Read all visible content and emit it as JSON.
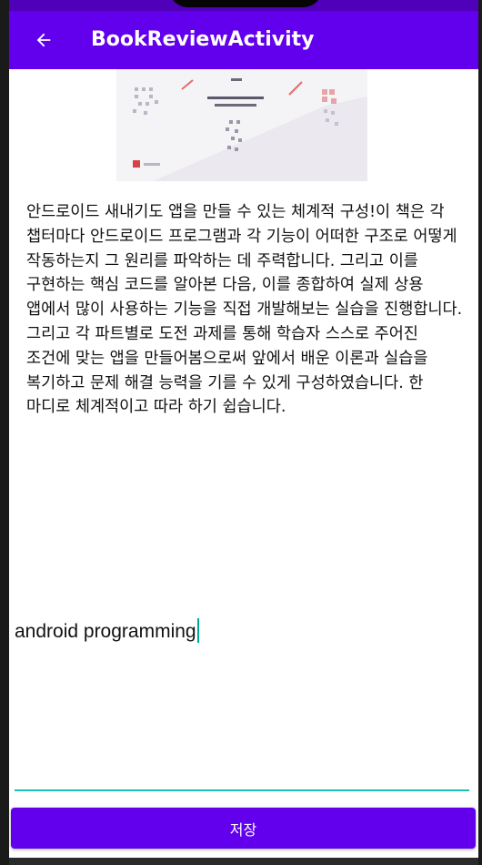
{
  "app_bar": {
    "title": "BookReviewActivity",
    "back_icon": "arrow-back-icon",
    "background": "#6200ee"
  },
  "book": {
    "cover_icon": "book-cover-image",
    "description": "안드로이드 새내기도 앱을 만들 수 있는 체계적 구성!이 책은 각 챕터마다 안드로이드 프로그램과 각 기능이 어떠한 구조로 어떻게 작동하는지 그 원리를 파악하는 데 주력합니다. 그리고 이를 구현하는 핵심 코드를 알아본 다음, 이를 종합하여 실제 상용 앱에서 많이 사용하는 기능을 직접 개발해보는 실습을 진행합니다. 그리고 각 파트별로 도전 과제를 통해 학습자 스스로 주어진 조건에 맞는 앱을 만들어봄으로써 앞에서 배운 이론과 실습을 복기하고 문제 해결 능력을 기를 수 있게 구성하였습니다. 한 마디로 체계적이고 따라 하기 쉽습니다."
  },
  "review": {
    "value": "android programming",
    "accent": "#17c3b2"
  },
  "save_button": {
    "label": "저장",
    "background": "#6200ee"
  }
}
